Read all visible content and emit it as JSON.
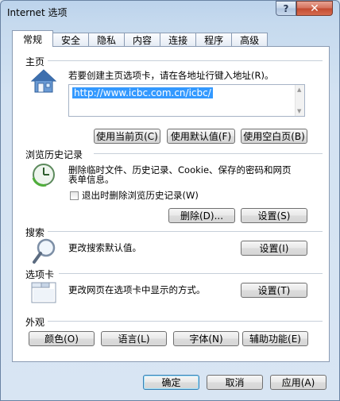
{
  "window": {
    "title": "Internet 选项",
    "help_label": "?",
    "close_label": "✕"
  },
  "tabs": [
    {
      "label": "常规",
      "active": true
    },
    {
      "label": "安全",
      "active": false
    },
    {
      "label": "隐私",
      "active": false
    },
    {
      "label": "内容",
      "active": false
    },
    {
      "label": "连接",
      "active": false
    },
    {
      "label": "程序",
      "active": false
    },
    {
      "label": "高级",
      "active": false
    }
  ],
  "home": {
    "section_label": "主页",
    "description": "若要创建主页选项卡，请在各地址行键入地址(R)。",
    "url_value": "http://www.icbc.com.cn/icbc/",
    "use_current_label": "使用当前页(C)",
    "use_default_label": "使用默认值(F)",
    "use_blank_label": "使用空白页(B)"
  },
  "history": {
    "section_label": "浏览历史记录",
    "description_line1": "删除临时文件、历史记录、Cookie、保存的密码和网页",
    "description_line2": "表单信息。",
    "checkbox_label": "退出时删除浏览历史记录(W)",
    "checkbox_checked": false,
    "delete_label": "删除(D)...",
    "settings_label": "设置(S)"
  },
  "search": {
    "section_label": "搜索",
    "description": "更改搜索默认值。",
    "settings_label": "设置(I)"
  },
  "tabs_section": {
    "section_label": "选项卡",
    "description": "更改网页在选项卡中显示的方式。",
    "settings_label": "设置(T)"
  },
  "appearance": {
    "section_label": "外观",
    "colors_label": "颜色(O)",
    "languages_label": "语言(L)",
    "fonts_label": "字体(N)",
    "accessibility_label": "辅助功能(E)"
  },
  "footer": {
    "ok_label": "确定",
    "cancel_label": "取消",
    "apply_label": "应用(A)"
  }
}
